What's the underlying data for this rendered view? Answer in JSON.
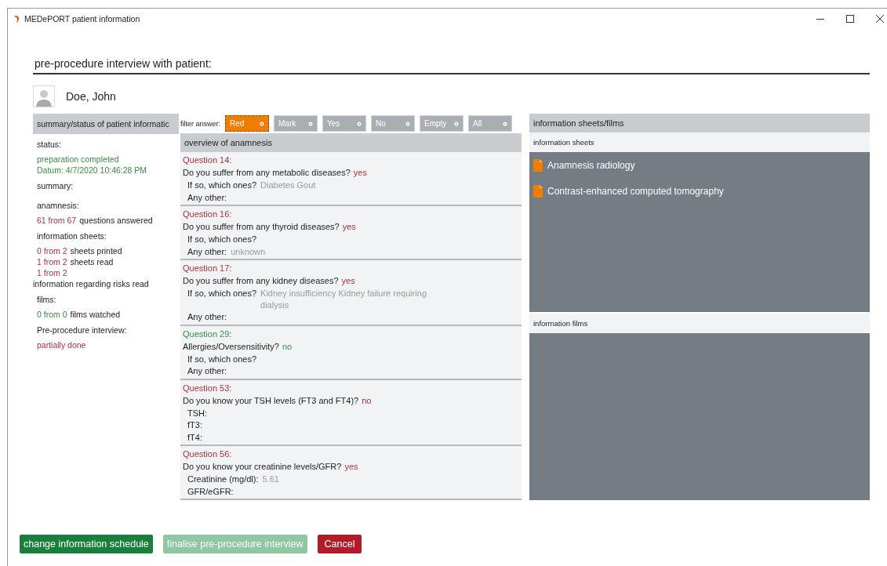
{
  "window": {
    "title": "MEDePORT patient information"
  },
  "heading": "pre-procedure interview with patient:",
  "patient": {
    "name": "Doe, John"
  },
  "summary": {
    "title": "summary/status of patient informatic",
    "sections": [
      {
        "heading": "status:",
        "lines": [
          {
            "kind": "status",
            "text": "preparation completed",
            "flagged": false
          },
          {
            "kind": "status",
            "text": "Datum: 4/7/2020 10:46:28 PM",
            "flagged": false
          }
        ]
      },
      {
        "heading": "summary:"
      },
      {
        "heading": "anamnesis:",
        "lines": [
          {
            "kind": "count",
            "count": "61 from 67",
            "text": "questions answered",
            "flagged": true
          }
        ]
      },
      {
        "heading": "information sheets:",
        "lines": [
          {
            "kind": "count",
            "count": "0 from 2",
            "text": "sheets printed",
            "flagged": true
          },
          {
            "kind": "count",
            "count": "1 from 2",
            "text": "sheets read",
            "flagged": true
          },
          {
            "kind": "status",
            "text": "1 from 2",
            "flagged": true
          },
          {
            "kind": "note",
            "text": "information regarding risks read"
          }
        ]
      },
      {
        "heading": "films:",
        "lines": [
          {
            "kind": "count",
            "count": "0 from 0",
            "text": "films watched",
            "flagged": false
          }
        ]
      },
      {
        "heading": "Pre-procedure interview:",
        "lines": [
          {
            "kind": "status",
            "text": "partially done",
            "flagged": true
          }
        ]
      }
    ]
  },
  "filter": {
    "label": "filter answer:",
    "chips": [
      {
        "label": "Red",
        "selected": true
      },
      {
        "label": "Mark",
        "selected": false
      },
      {
        "label": "Yes",
        "selected": false
      },
      {
        "label": "No",
        "selected": false
      },
      {
        "label": "Empty",
        "selected": false
      },
      {
        "label": "All",
        "selected": false
      }
    ]
  },
  "anamnesis": {
    "title": "overview of anamnesis",
    "questions": [
      {
        "number": "Question  14:",
        "flagged": true,
        "text": "Do you suffer from any metabolic diseases?",
        "answer": "yes",
        "fields": [
          {
            "label": "If so, which ones?",
            "value": "Diabetes Gout"
          },
          {
            "label": "Any other:"
          }
        ]
      },
      {
        "number": "Question  16:",
        "flagged": true,
        "text": "Do you suffer from any thyroid diseases?",
        "answer": "yes",
        "fields": [
          {
            "label": "If so, which ones?"
          },
          {
            "label": "Any other:",
            "value": "unknown"
          }
        ]
      },
      {
        "number": "Question  17:",
        "flagged": true,
        "text": "Do you suffer from any kidney diseases?",
        "answer": "yes",
        "fields": [
          {
            "label": "If so, which ones?",
            "value": "Kidney insufficiency Kidney failure requiring dialysis"
          },
          {
            "label": "Any other:"
          }
        ]
      },
      {
        "number": "Question  29:",
        "flagged": false,
        "text": "Allergies/Oversensitivity?",
        "answer": "no",
        "fields": [
          {
            "label": "If so, which ones?"
          },
          {
            "label": "Any other:"
          }
        ]
      },
      {
        "number": "Question  53:",
        "flagged": true,
        "text": "Do you know your TSH levels (FT3 and FT4)?",
        "answer": "no",
        "fields": [
          {
            "label": "TSH:"
          },
          {
            "label": "fT3:"
          },
          {
            "label": "fT4:"
          }
        ]
      },
      {
        "number": "Question  56:",
        "flagged": true,
        "text": "Do you know your creatinine levels/GFR?",
        "answer": "yes",
        "fields": [
          {
            "label": "Creatinine (mg/dl):",
            "value": "5.61"
          },
          {
            "label": "GFR/eGFR:"
          }
        ]
      }
    ]
  },
  "materials": {
    "title": "information sheets/films",
    "sheets_title": "information sheets",
    "sheets": [
      "Anamnesis radiology",
      "Contrast-enhanced computed tomography"
    ],
    "films_title": "information films"
  },
  "buttons": [
    {
      "label": "change information schedule",
      "kind": "confirm",
      "disabled": false
    },
    {
      "label": "finalise pre-procedure interview",
      "kind": "confirm",
      "disabled": true
    },
    {
      "label": "Cancel",
      "kind": "cancel",
      "disabled": false
    }
  ]
}
